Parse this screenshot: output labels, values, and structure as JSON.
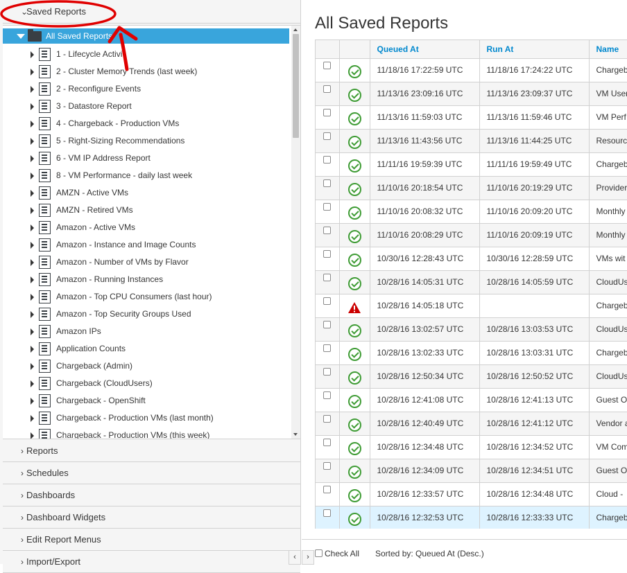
{
  "accordion": {
    "saved_reports": "Saved Reports",
    "reports": "Reports",
    "schedules": "Schedules",
    "dashboards": "Dashboards",
    "dashboard_widgets": "Dashboard Widgets",
    "edit_report_menus": "Edit Report Menus",
    "import_export": "Import/Export"
  },
  "tree": {
    "root": "All Saved Reports",
    "items": [
      "1 - Lifecycle Activi",
      "2 - Cluster Memory Trends (last week)",
      "2 - Reconfigure Events",
      "3 - Datastore Report",
      "4 - Chargeback - Production VMs",
      "5 - Right-Sizing Recommendations",
      "6 - VM IP Address Report",
      "8 - VM Performance - daily last week",
      "AMZN - Active VMs",
      "AMZN - Retired VMs",
      "Amazon - Active VMs",
      "Amazon - Instance and Image Counts",
      "Amazon - Number of VMs by Flavor",
      "Amazon - Running Instances",
      "Amazon - Top CPU Consumers (last hour)",
      "Amazon - Top Security Groups Used",
      "Amazon IPs",
      "Application Counts",
      "Chargeback (Admin)",
      "Chargeback (CloudUsers)",
      "Chargeback - OpenShift",
      "Chargeback - Production VMs (last month)",
      "Chargeback - Production VMs (this week)"
    ]
  },
  "main": {
    "title": "All Saved Reports",
    "columns": [
      "Queued At",
      "Run At",
      "Name"
    ],
    "rows": [
      {
        "queued": "11/18/16 17:22:59 UTC",
        "run": "11/18/16 17:24:22 UTC",
        "name": "Chargeb",
        "status": "ok"
      },
      {
        "queued": "11/13/16 23:09:16 UTC",
        "run": "11/13/16 23:09:37 UTC",
        "name": "VM User",
        "status": "ok"
      },
      {
        "queued": "11/13/16 11:59:03 UTC",
        "run": "11/13/16 11:59:46 UTC",
        "name": "VM Perf",
        "status": "ok"
      },
      {
        "queued": "11/13/16 11:43:56 UTC",
        "run": "11/13/16 11:44:25 UTC",
        "name": "Resourc",
        "status": "ok"
      },
      {
        "queued": "11/11/16 19:59:39 UTC",
        "run": "11/11/16 19:59:49 UTC",
        "name": "Chargeb",
        "status": "ok"
      },
      {
        "queued": "11/10/16 20:18:54 UTC",
        "run": "11/10/16 20:19:29 UTC",
        "name": "Provider",
        "status": "ok"
      },
      {
        "queued": "11/10/16 20:08:32 UTC",
        "run": "11/10/16 20:09:20 UTC",
        "name": "Monthly",
        "status": "ok"
      },
      {
        "queued": "11/10/16 20:08:29 UTC",
        "run": "11/10/16 20:09:19 UTC",
        "name": "Monthly",
        "status": "ok"
      },
      {
        "queued": "10/30/16 12:28:43 UTC",
        "run": "10/30/16 12:28:59 UTC",
        "name": "VMs wit",
        "status": "ok"
      },
      {
        "queued": "10/28/16 14:05:31 UTC",
        "run": "10/28/16 14:05:59 UTC",
        "name": "CloudUs",
        "status": "ok"
      },
      {
        "queued": "10/28/16 14:05:18 UTC",
        "run": "",
        "name": "Chargeb",
        "status": "error"
      },
      {
        "queued": "10/28/16 13:02:57 UTC",
        "run": "10/28/16 13:03:53 UTC",
        "name": "CloudUs",
        "status": "ok"
      },
      {
        "queued": "10/28/16 13:02:33 UTC",
        "run": "10/28/16 13:03:31 UTC",
        "name": "Chargeb",
        "status": "ok"
      },
      {
        "queued": "10/28/16 12:50:34 UTC",
        "run": "10/28/16 12:50:52 UTC",
        "name": "CloudUs",
        "status": "ok"
      },
      {
        "queued": "10/28/16 12:41:08 UTC",
        "run": "10/28/16 12:41:13 UTC",
        "name": "Guest O",
        "status": "ok"
      },
      {
        "queued": "10/28/16 12:40:49 UTC",
        "run": "10/28/16 12:41:12 UTC",
        "name": "Vendor a",
        "status": "ok"
      },
      {
        "queued": "10/28/16 12:34:48 UTC",
        "run": "10/28/16 12:34:52 UTC",
        "name": "VM Com",
        "status": "ok"
      },
      {
        "queued": "10/28/16 12:34:09 UTC",
        "run": "10/28/16 12:34:51 UTC",
        "name": "Guest O",
        "status": "ok"
      },
      {
        "queued": "10/28/16 12:33:57 UTC",
        "run": "10/28/16 12:34:48 UTC",
        "name": "Cloud - ",
        "status": "ok"
      },
      {
        "queued": "10/28/16 12:32:53 UTC",
        "run": "10/28/16 12:33:33 UTC",
        "name": "Chargeb",
        "status": "ok",
        "selected": true
      }
    ]
  },
  "footer": {
    "check_all": "Check All",
    "sorted_by": "Sorted by: Queued At (Desc.)",
    "prev": "‹",
    "next": "›"
  },
  "colors": {
    "accent": "#39a5dc",
    "link": "#0088ce",
    "ok": "#3f9c35",
    "error": "#cc0000",
    "annotation": "#e00000"
  }
}
